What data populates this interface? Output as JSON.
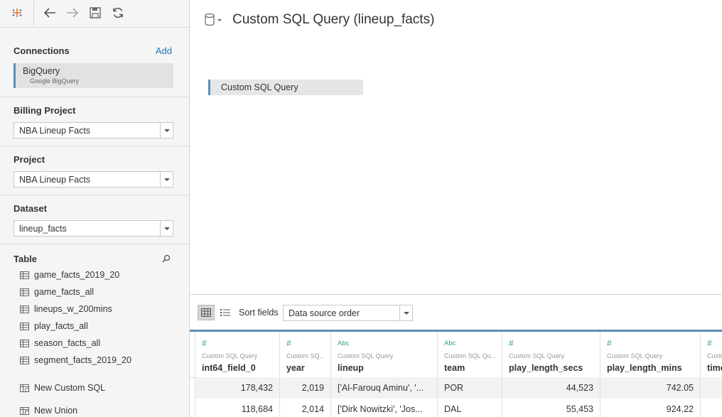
{
  "toolbar": {
    "icons": [
      "tableau-logo-icon",
      "back-icon",
      "forward-icon",
      "save-icon",
      "refresh-icon"
    ]
  },
  "connections": {
    "title": "Connections",
    "add_label": "Add",
    "items": [
      {
        "name": "BigQuery",
        "subtitle": "Google BigQuery"
      }
    ]
  },
  "billing_project": {
    "title": "Billing Project",
    "value": "NBA Lineup Facts"
  },
  "project": {
    "title": "Project",
    "value": "NBA Lineup Facts"
  },
  "dataset": {
    "title": "Dataset",
    "value": "lineup_facts"
  },
  "table_section": {
    "title": "Table",
    "items": [
      {
        "label": "game_facts_2019_20"
      },
      {
        "label": "game_facts_all"
      },
      {
        "label": "lineups_w_200mins"
      },
      {
        "label": "play_facts_all"
      },
      {
        "label": "season_facts_all"
      },
      {
        "label": "segment_facts_2019_20"
      }
    ],
    "new_custom_sql": "New Custom SQL",
    "new_union": "New Union"
  },
  "main": {
    "title": "Custom SQL Query (lineup_facts)",
    "query_pill": "Custom SQL Query"
  },
  "grid_toolbar": {
    "sort_label": "Sort fields",
    "sort_value": "Data source order"
  },
  "grid": {
    "columns": [
      {
        "type": "#",
        "source": "Custom SQL Query",
        "name": "int64_field_0",
        "align": "right"
      },
      {
        "type": "#",
        "source": "Custom SQ...",
        "name": "year",
        "align": "right"
      },
      {
        "type": "Abc",
        "source": "Custom SQL Query",
        "name": "lineup",
        "align": "left"
      },
      {
        "type": "Abc",
        "source": "Custom SQL Qu...",
        "name": "team",
        "align": "left"
      },
      {
        "type": "#",
        "source": "Custom SQL Query",
        "name": "play_length_secs",
        "align": "right"
      },
      {
        "type": "#",
        "source": "Custom SQL Query",
        "name": "play_length_mins",
        "align": "right"
      },
      {
        "type": "#",
        "source": "Custo",
        "name": "time",
        "align": "right"
      }
    ],
    "rows": [
      [
        "178,432",
        "2,019",
        "['Al-Farouq Aminu', '...",
        "POR",
        "44,523",
        "742.05",
        ""
      ],
      [
        "118,684",
        "2,014",
        "['Dirk Nowitzki', 'Jos...",
        "DAL",
        "55,453",
        "924.22",
        ""
      ]
    ]
  },
  "colors": {
    "accent": "#5b8fb9",
    "link": "#1f77b4",
    "type_icon": "#3aa66a"
  }
}
